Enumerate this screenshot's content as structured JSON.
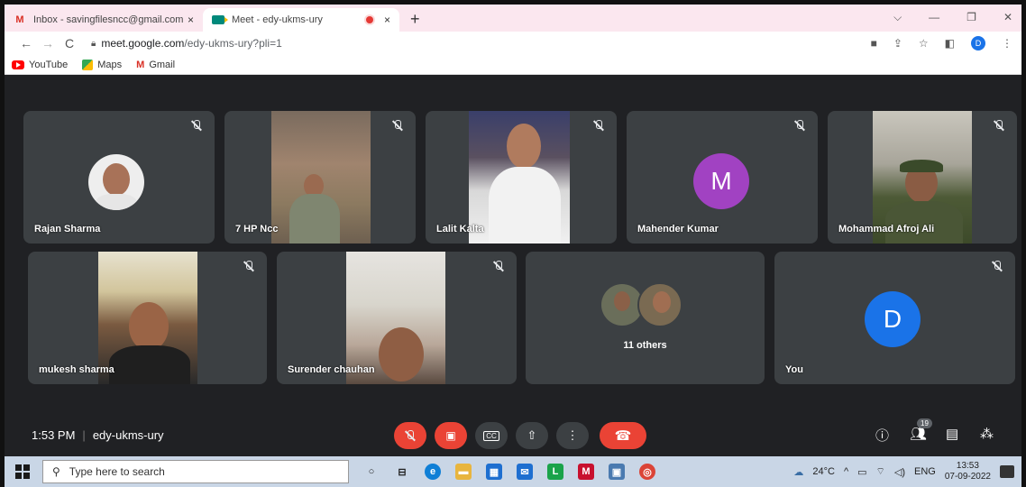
{
  "browser": {
    "tabs": [
      {
        "title": "Inbox - savingfilesncc@gmail.com",
        "close": "×"
      },
      {
        "title": "Meet - edy-ukms-ury",
        "close": "×"
      }
    ],
    "new_tab": "+",
    "window_controls": [
      "⌵",
      "—",
      "❐",
      "✕"
    ],
    "url_host": "meet.google.com",
    "url_path": "/edy-ukms-ury?pli=1",
    "profile_initial": "D",
    "bookmarks": [
      "YouTube",
      "Maps",
      "Gmail"
    ]
  },
  "participants": [
    {
      "name": "Rajan Sharma"
    },
    {
      "name": "7 HP Ncc"
    },
    {
      "name": "Lalit Kalta"
    },
    {
      "name": "Mahender Kumar",
      "initial": "M",
      "color": "#a142c2"
    },
    {
      "name": "Mohammad Afroj Ali"
    },
    {
      "name": "mukesh sharma"
    },
    {
      "name": "Surender chauhan"
    },
    {
      "name": "11 others"
    },
    {
      "name": "You",
      "initial": "D",
      "color": "#1a73e8"
    }
  ],
  "meeting": {
    "time": "1:53 PM",
    "separator": "|",
    "code": "edy-ukms-ury",
    "people_count": "19"
  },
  "controls": {
    "captions_label": "CC"
  },
  "taskbar": {
    "search_placeholder": "Type here to search",
    "weather": "24°C",
    "language": "ENG",
    "time": "13:53",
    "date": "07-09-2022"
  },
  "colors": {
    "meet_bg": "#202124",
    "tile_bg": "#3c4043",
    "end_call": "#ea4335",
    "tabstrip": "#fbe7ef",
    "taskbar": "#c9d6e6"
  }
}
